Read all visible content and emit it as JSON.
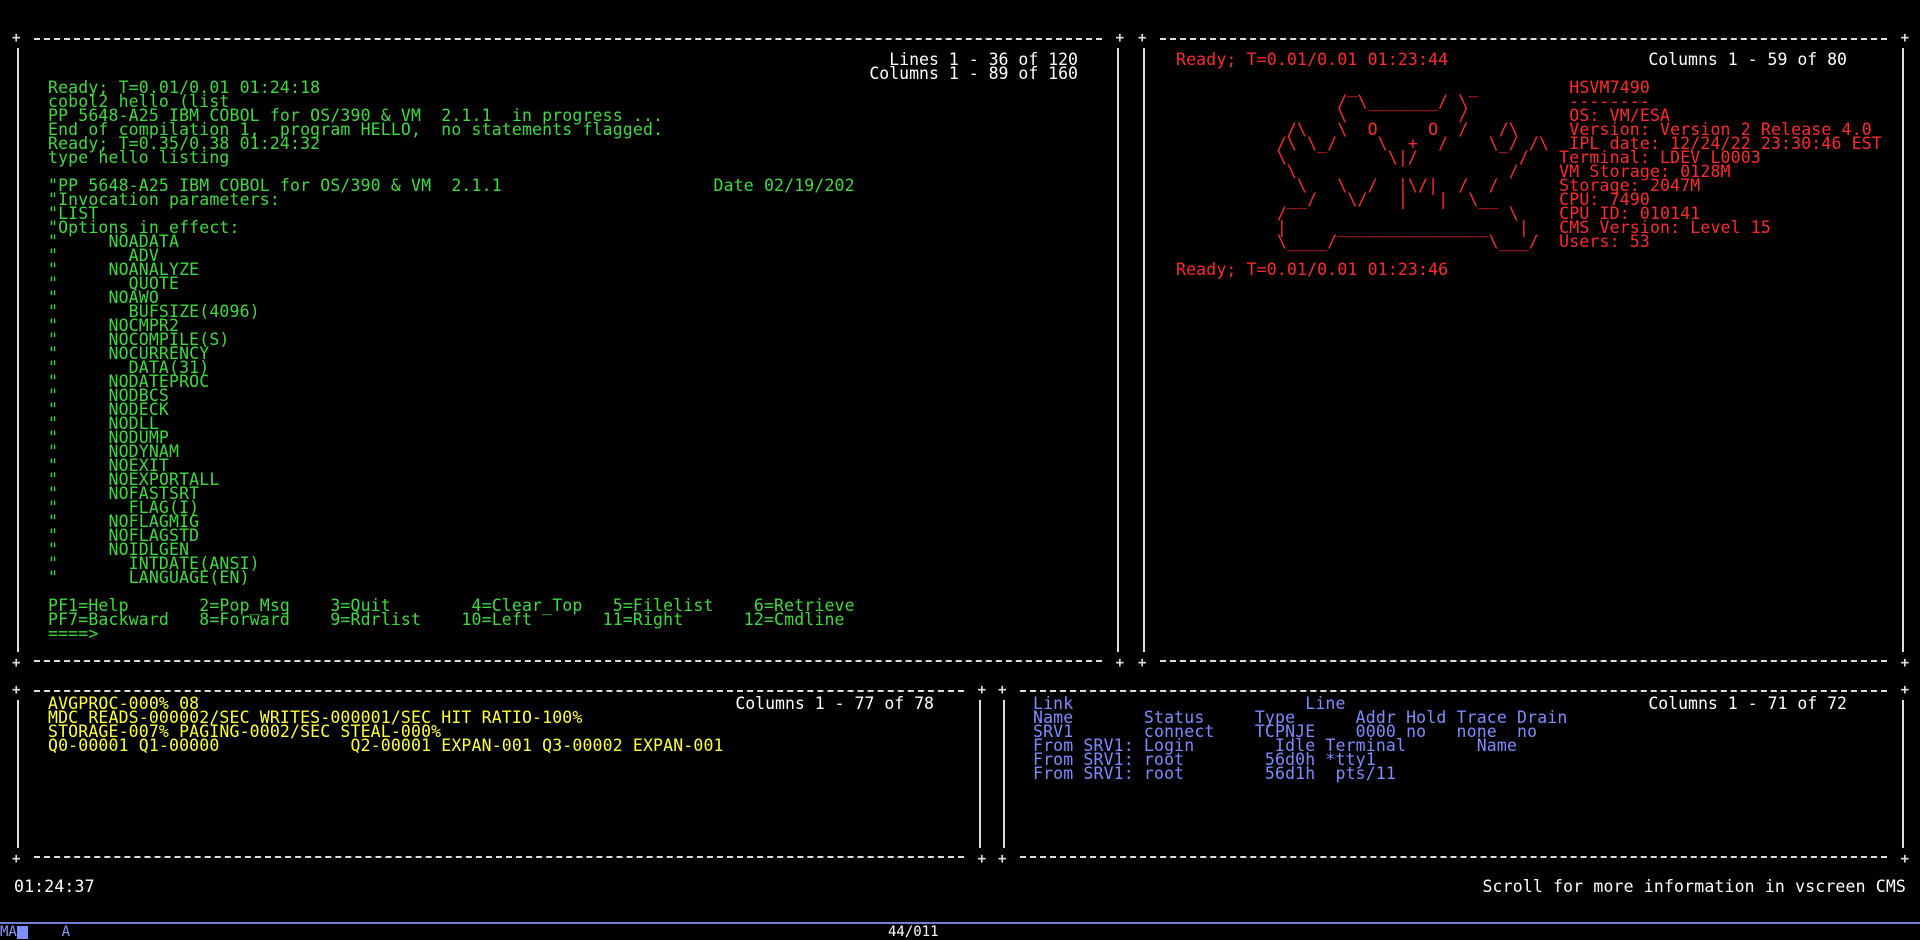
{
  "colors": {
    "bg": "#000000",
    "green": "#3cdc3c",
    "red": "#ff2a2a",
    "yellow": "#ffff38",
    "blue": "#7d8cff",
    "white": "#ffffff"
  },
  "pane_top_left": {
    "header_lines": "Lines 1 - 36 of 120",
    "header_columns": "Columns 1 - 89 of 160",
    "lines": [
      "Ready; T=0.01/0.01 01:24:18",
      "cobol2 hello (list",
      "PP 5648-A25 IBM COBOL for OS/390 & VM  2.1.1  in progress ...",
      "End of compilation 1,  program HELLO,  no statements flagged.",
      "Ready; T=0.35/0.38 01:24:32",
      "type hello listing",
      "",
      "\"PP 5648-A25 IBM COBOL for OS/390 & VM  2.1.1                     Date 02/19/202",
      "\"Invocation parameters:",
      "\"LIST",
      "\"Options in effect:",
      "\"     NOADATA",
      "\"       ADV",
      "\"     NOANALYZE",
      "\"       QUOTE",
      "\"     NOAWO",
      "\"       BUFSIZE(4096)",
      "\"     NOCMPR2",
      "\"     NOCOMPILE(S)",
      "\"     NOCURRENCY",
      "\"       DATA(31)",
      "\"     NODATEPROC",
      "\"     NODBCS",
      "\"     NODECK",
      "\"     NODLL",
      "\"     NODUMP",
      "\"     NODYNAM",
      "\"     NOEXIT",
      "\"     NOEXPORTALL",
      "\"     NOFASTSRT",
      "\"       FLAG(I)",
      "\"     NOFLAGMIG",
      "\"     NOFLAGSTD",
      "\"     NOIDLGEN",
      "\"       INTDATE(ANSI)",
      "\"       LANGUAGE(EN)",
      "",
      "PF1=Help       2=Pop_Msg    3=Quit        4=Clear_Top   5=Filelist    6=Retrieve",
      "PF7=Backward   8=Forward    9=Rdrlist    10=Left       11=Right      12=Cmdline",
      "====>"
    ]
  },
  "pane_top_right": {
    "ready_line": "Ready; T=0.01/0.01 01:23:44",
    "header_columns": "Columns 1 - 59 of 80",
    "lines": [
      "                 _           _         HSVM7490",
      "                / \\_______/ \\          --------",
      "                \\           /          OS: VM/ESA",
      "           /\\   \\  O     O  /   /\\     Version: Version 2 Release 4.0",
      "          /\\ \\_/    \\  +  /    \\_/ /\\  IPL date: 12/24/22 23:30:46 EST",
      "          \\          \\|/          /   Terminal: LDEV L0003",
      "           \\                     /    VM Storage: 0128M",
      "            \\   \\  /  |\\/|  /  /      Storage: 2047M",
      "           __/   \\/   |   |  \\__      CPU: 7490",
      "          /                      \\    CPU ID: 010141",
      "          |     _______________   |   CMS Version: Level 15",
      "          \\____/               \\___/  Users: 53",
      "",
      "Ready; T=0.01/0.01 01:23:46"
    ]
  },
  "pane_bottom_left": {
    "header_columns": "Columns 1 - 77 of 78",
    "lines": [
      "AVGPROC-000% 08",
      "MDC READS-000002/SEC WRITES-000001/SEC HIT RATIO-100%",
      "STORAGE-007% PAGING-0002/SEC STEAL-000%",
      "Q0-00001 Q1-00000             Q2-00001 EXPAN-001 Q3-00002 EXPAN-001"
    ]
  },
  "pane_bottom_right": {
    "header_columns": "Columns 1 - 71 of 72",
    "lines": [
      "Link                       Line",
      "Name       Status     Type      Addr Hold Trace Drain",
      "SRV1       connect    TCPNJE    0000 no   none  no",
      "From SRV1: Login        Idle Terminal       Name",
      "From SRV1: root        56d0h *tty1",
      "From SRV1: root        56d1h  pts/11"
    ]
  },
  "footer": {
    "clock": "01:24:37",
    "scroll_message": "Scroll for more information in vscreen CMS"
  },
  "statusbar": {
    "left_text": "MA",
    "mode_text": "A",
    "center_text": "44/011"
  }
}
